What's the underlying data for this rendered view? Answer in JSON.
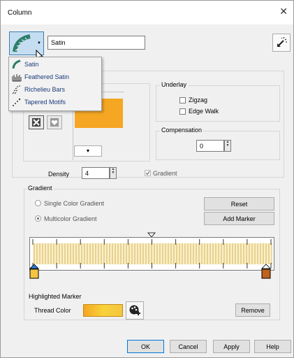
{
  "window": {
    "title": "Column",
    "close_glyph": "✕"
  },
  "stitch_type": {
    "value": "Satin"
  },
  "menu": {
    "items": [
      {
        "label": "Satin",
        "icon": "satin-icon"
      },
      {
        "label": "Feathered Satin",
        "icon": "feathered-satin-icon"
      },
      {
        "label": "Richelieu Bars",
        "icon": "richelieu-bars-icon"
      },
      {
        "label": "Tapered Motifs",
        "icon": "tapered-motifs-icon"
      }
    ]
  },
  "underlay": {
    "title": "Underlay",
    "zigzag": "Zigzag",
    "edge_walk": "Edge Walk"
  },
  "compensation": {
    "title": "Compensation",
    "value": "0"
  },
  "density": {
    "label": "Density",
    "value": "4",
    "gradient_label": "Gradient",
    "gradient_checked": true
  },
  "gradient": {
    "title": "Gradient",
    "single_label": "Single Color Gradient",
    "multi_label": "Multicolor Gradient",
    "selected": "multi",
    "reset_label": "Reset",
    "add_marker_label": "Add Marker"
  },
  "highlighted": {
    "title": "Highlighted Marker",
    "thread_color_label": "Thread Color",
    "remove_label": "Remove"
  },
  "footer": {
    "ok": "OK",
    "cancel": "Cancel",
    "apply": "Apply",
    "help": "Help"
  },
  "colors": {
    "thread": "#f5a623",
    "marker_start": "#2a7fd4",
    "marker_end": "#c0621a",
    "menu_text": "#1a3a7a"
  }
}
